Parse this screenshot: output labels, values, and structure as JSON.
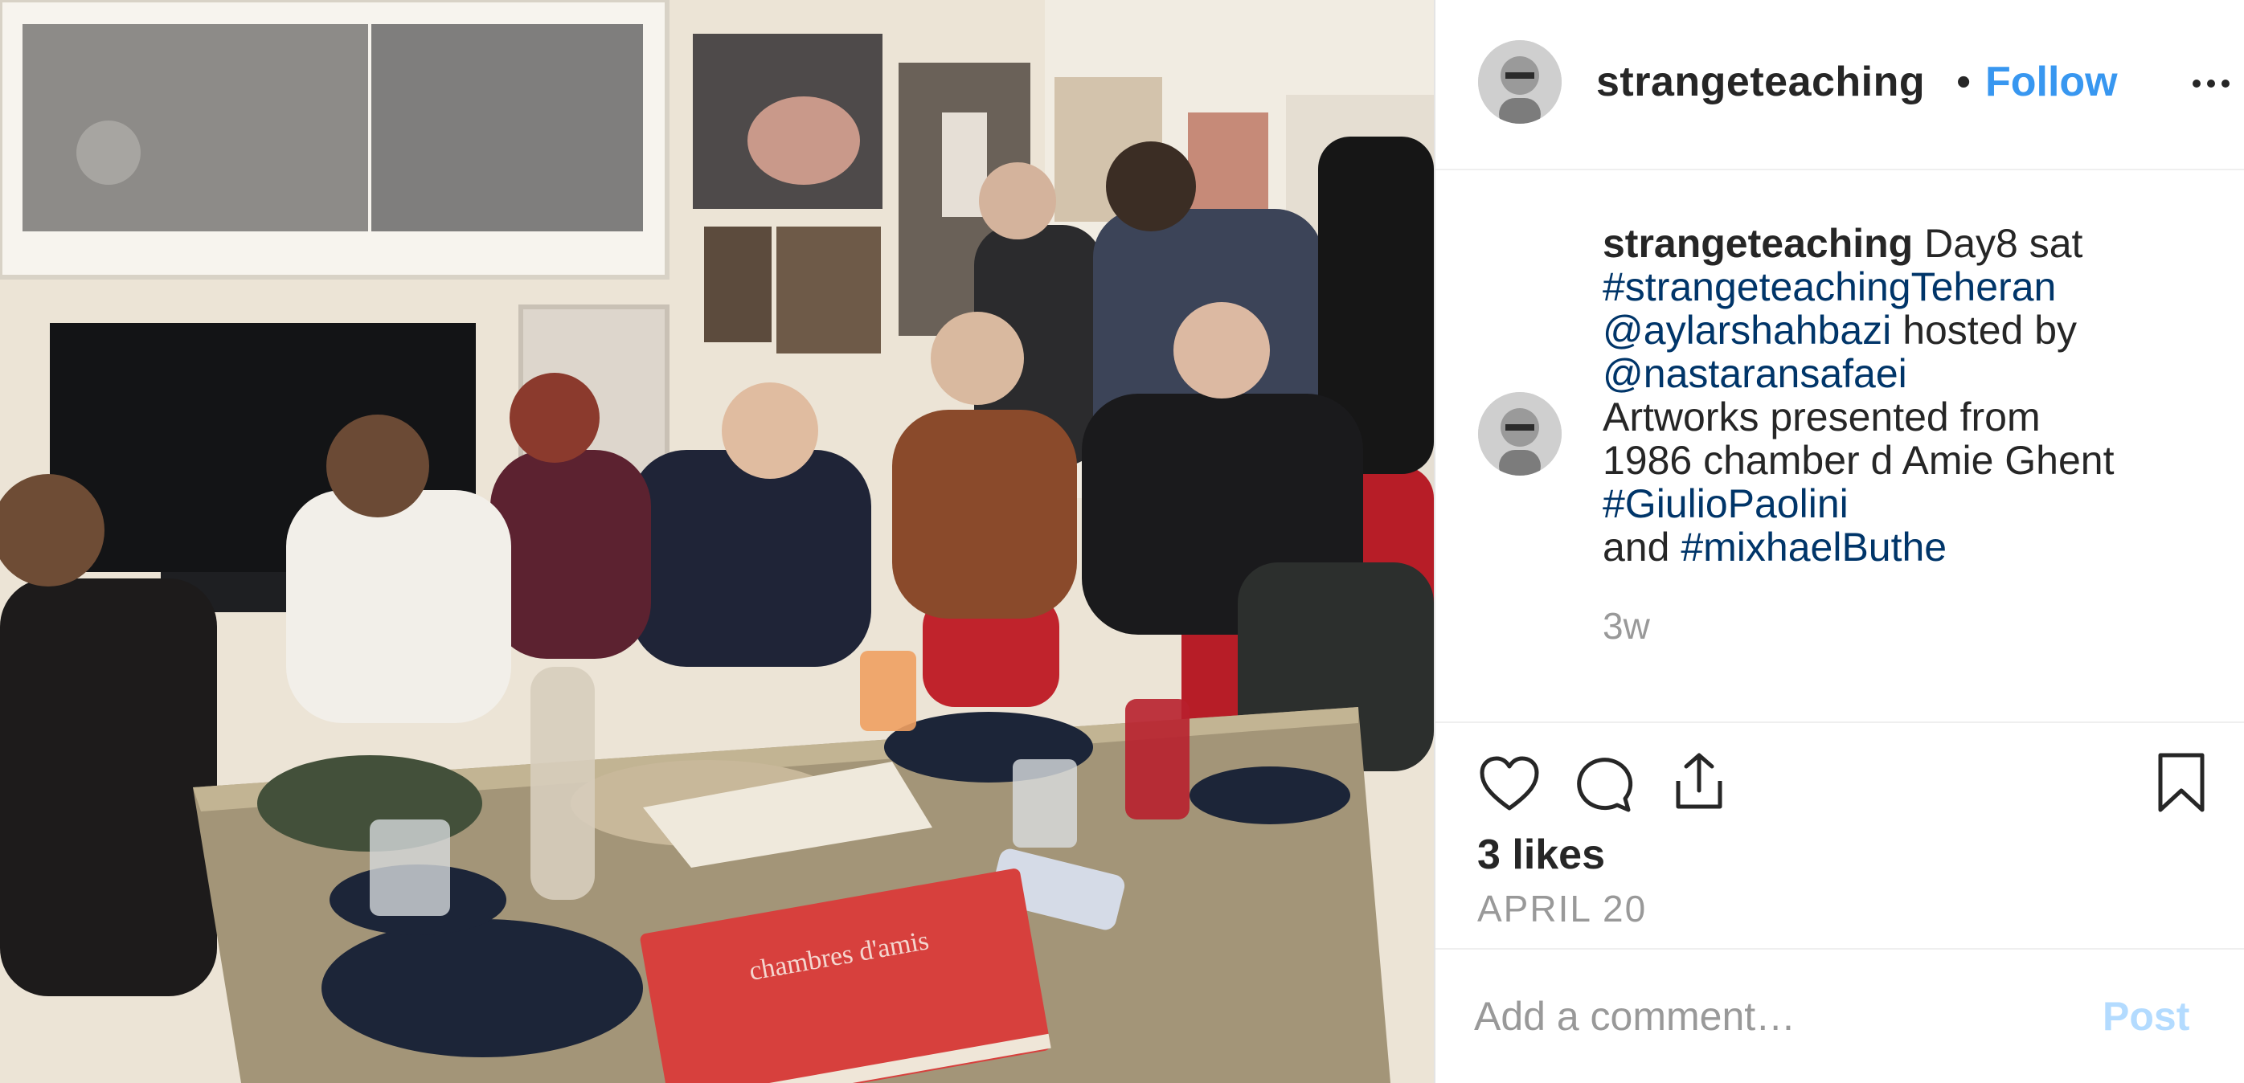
{
  "post": {
    "username": "strangeteaching",
    "follow_label": "Follow",
    "separator": "•",
    "caption": {
      "username": "strangeteaching",
      "text_1": "Day8 sat",
      "tag_1": "#strangeteachingTeheran",
      "mention_1": "@aylarshahbazi",
      "text_2": "hosted by",
      "mention_2": "@nastaransafaei",
      "text_3": "Artworks presented from",
      "text_4": "1986 chamber d Amie Ghent",
      "tag_2": "#GiulioPaolini",
      "text_5": "and",
      "tag_3": "#mixhaelButhe"
    },
    "time_ago": "3w",
    "likes": "3 likes",
    "date": "APRIL 20"
  },
  "comment_form": {
    "placeholder": "Add a comment…",
    "post_label": "Post"
  },
  "photo": {
    "book_title": "chambres d'amis"
  },
  "icons": {
    "more": "more-icon",
    "like": "heart-icon",
    "comment": "comment-icon",
    "share": "share-icon",
    "save": "bookmark-icon",
    "avatar": "avatar"
  },
  "colors": {
    "link": "#3897f0",
    "hashtag": "#003569",
    "muted": "#999999",
    "post_disabled": "#b3dbff",
    "text": "#262626"
  }
}
